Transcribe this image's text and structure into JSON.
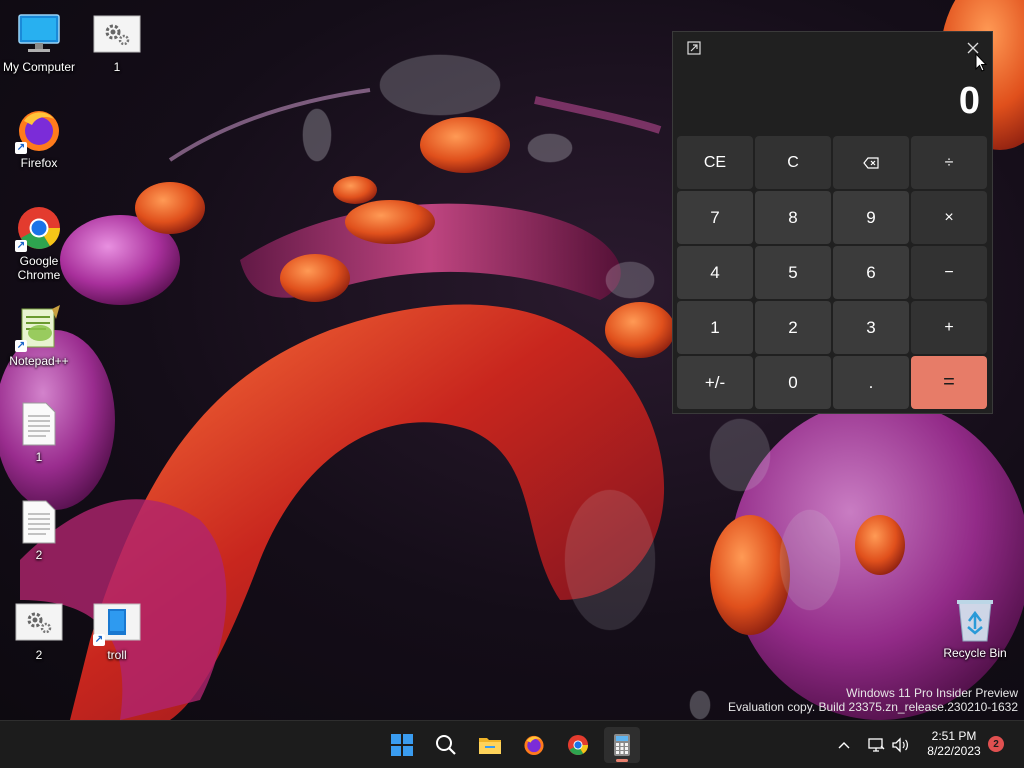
{
  "desktop": {
    "icons": [
      {
        "label": "My Computer",
        "icon": "monitor-icon"
      },
      {
        "label": "1",
        "icon": "gear-file-icon"
      },
      {
        "label": "Firefox",
        "icon": "firefox-icon"
      },
      {
        "label": "Google Chrome",
        "icon": "chrome-icon"
      },
      {
        "label": "Notepad++",
        "icon": "notepadpp-icon"
      },
      {
        "label": "1",
        "icon": "text-file-icon"
      },
      {
        "label": "2",
        "icon": "text-file-icon"
      },
      {
        "label": "2",
        "icon": "gear-file-icon"
      },
      {
        "label": "troll",
        "icon": "app-shortcut-icon"
      },
      {
        "label": "Recycle Bin",
        "icon": "recycle-bin-icon"
      }
    ]
  },
  "calculator": {
    "display": "0",
    "keys": [
      [
        "CE",
        "C",
        "⌫",
        "÷"
      ],
      [
        "7",
        "8",
        "9",
        "×"
      ],
      [
        "4",
        "5",
        "6",
        "−"
      ],
      [
        "1",
        "2",
        "3",
        "+"
      ],
      [
        "+/-",
        "0",
        ".",
        "="
      ]
    ],
    "accent_color": "#e77c68"
  },
  "watermark": {
    "line1": "Windows 11 Pro Insider Preview",
    "line2": "Evaluation copy. Build 23375.zn_release.230210-1632"
  },
  "taskbar": {
    "apps": [
      "start-icon",
      "search-icon",
      "file-explorer-icon",
      "firefox-icon",
      "chrome-icon",
      "calculator-icon"
    ],
    "tray": {
      "time": "2:51 PM",
      "date": "8/22/2023",
      "notification_count": "2"
    }
  }
}
